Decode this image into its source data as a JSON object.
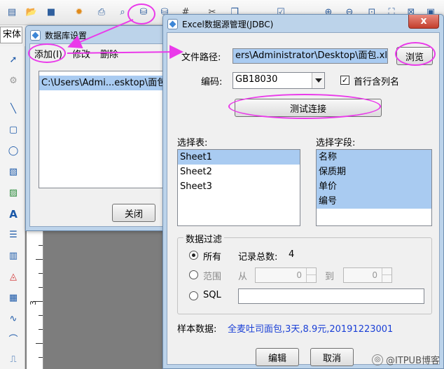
{
  "app": {
    "font_name": "宋体",
    "ruler_number": "3",
    "toolbar_icons": [
      "new-icon",
      "open-icon",
      "save-icon",
      "gear-icon",
      "print-icon",
      "preview-icon",
      "database-icon",
      "database2-icon",
      "grid-icon",
      "cut-icon",
      "copy-icon",
      "check-icon",
      "zoom-in-icon",
      "zoom-out-icon",
      "fit-icon",
      "fullscreen-icon",
      "delete-icon",
      "select-all-icon",
      "move-icon",
      "align-icon"
    ],
    "left_tools": [
      "pointer-icon",
      "lock-icon",
      "line-icon",
      "rectangle-icon",
      "ellipse-icon",
      "image-icon",
      "picture-icon",
      "text-icon",
      "multiline-text-icon",
      "barcode-icon",
      "shape-icon",
      "qrcode-icon",
      "curve-icon",
      "arc-icon",
      "path-icon"
    ]
  },
  "db_dialog": {
    "title": "数据库设置",
    "close_symbol": "x",
    "menu": [
      "添加(I)",
      "修改",
      "删除"
    ],
    "connections": [
      "C:\\Users\\Admi...esktop\\面包.xls"
    ],
    "close_button": "关闭"
  },
  "excel_dialog": {
    "title": "Excel数据源管理(JDBC)",
    "close_symbol": "x",
    "file_path_label": "文件路径:",
    "file_path_value": "ers\\Administrator\\Desktop\\面包.xls",
    "browse_button": "浏览",
    "encoding_label": "编码:",
    "encoding_value": "GB18030",
    "header_checkbox_label": "首行含列名",
    "header_checked": true,
    "test_button": "测试连接",
    "select_table_label": "选择表:",
    "tables": [
      "Sheet1",
      "Sheet2",
      "Sheet3"
    ],
    "selected_table": "Sheet1",
    "select_field_label": "选择字段:",
    "fields": [
      "名称",
      "保质期",
      "单价",
      "编号"
    ],
    "filter": {
      "title": "数据过滤",
      "all_label": "所有",
      "total_label": "记录总数:",
      "total_value": "4",
      "range_label": "范围",
      "from_label": "从",
      "from_value": "0",
      "to_label": "到",
      "to_value": "0",
      "sql_label": "SQL",
      "sql_value": ""
    },
    "sample_label": "样本数据:",
    "sample_value": "全麦吐司面包,3天,8.9元,20191223001",
    "edit_button": "编辑",
    "cancel_button": "取消"
  },
  "watermark": "@ITPUB博客",
  "colors": {
    "annotation": "#ea3aea",
    "selection": "#a9cbf1",
    "sample_text": "#1a3fd6"
  }
}
